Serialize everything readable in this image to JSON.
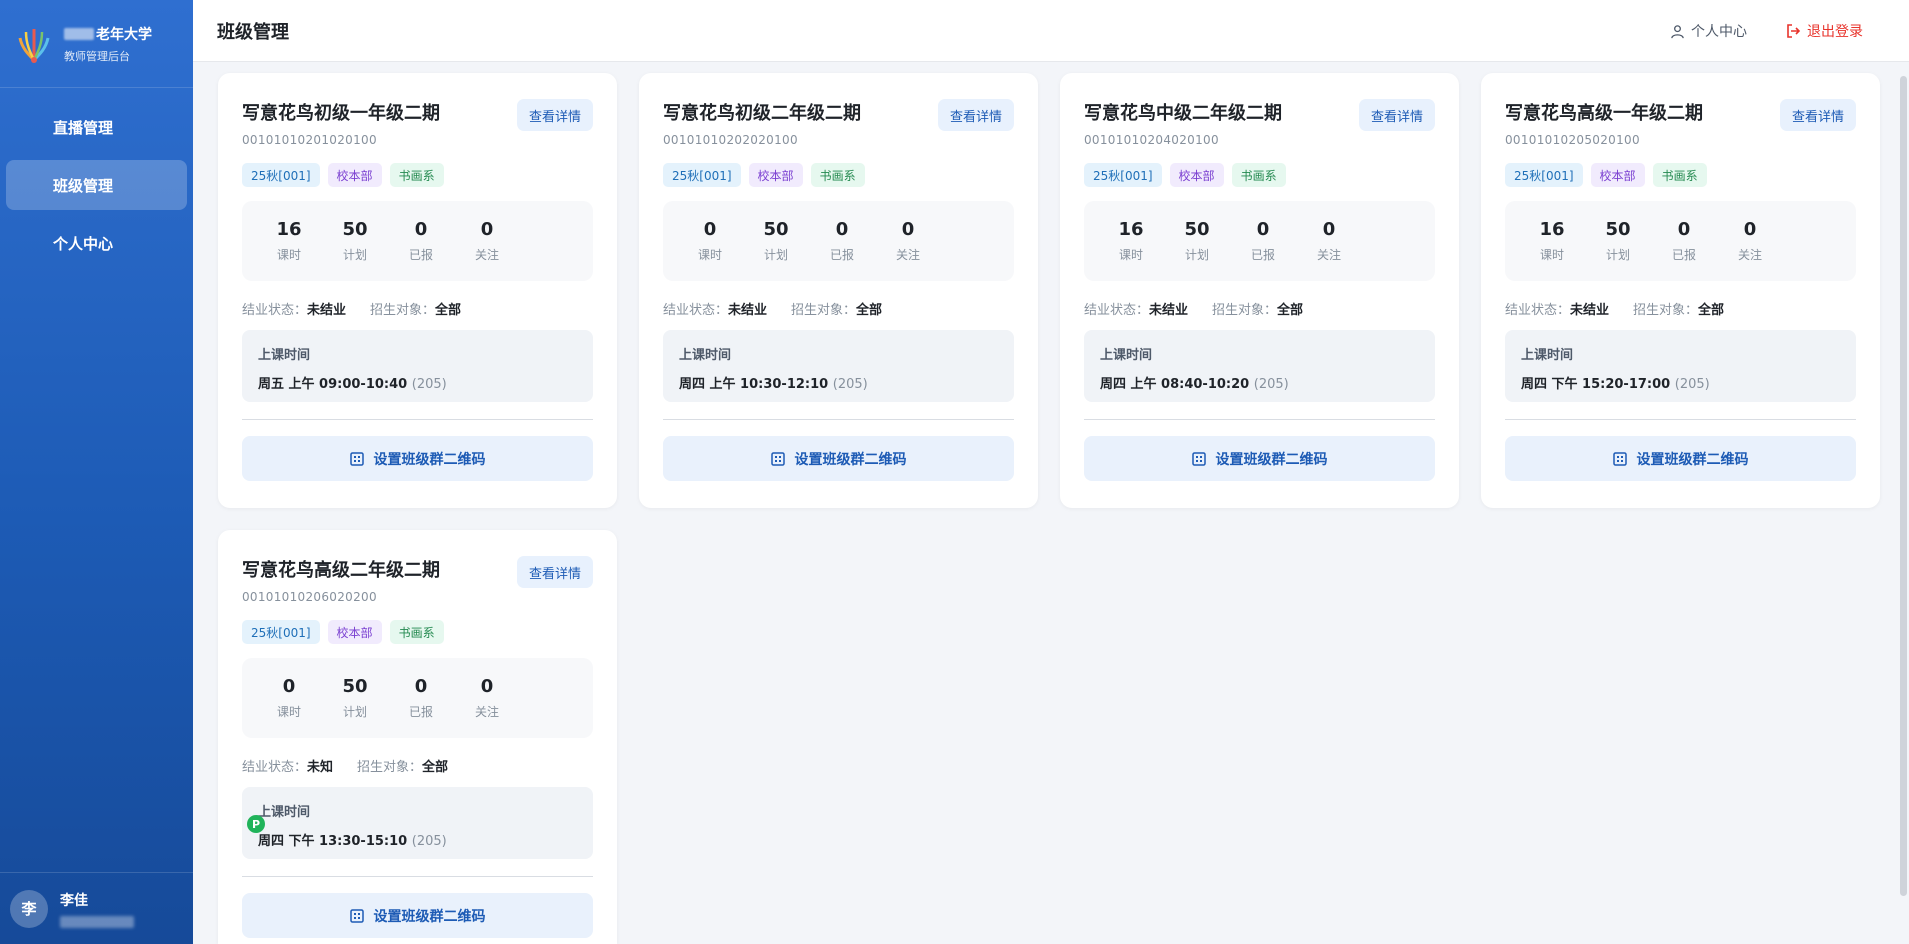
{
  "brand": {
    "name": "老年大学",
    "subtitle": "教师管理后台"
  },
  "sidebar": {
    "items": [
      {
        "label": "直播管理",
        "active": false
      },
      {
        "label": "班级管理",
        "active": true
      },
      {
        "label": "个人中心",
        "active": false
      }
    ]
  },
  "user": {
    "avatar_char": "李",
    "name": "李佳"
  },
  "header": {
    "title": "班级管理",
    "profile_label": "个人中心",
    "logout_label": "退出登录"
  },
  "labels": {
    "detail": "查看详情",
    "stat_lessons": "课时",
    "stat_plan": "计划",
    "stat_enrolled": "已报",
    "stat_follow": "关注",
    "status_label": "结业状态：",
    "target_label": "招生对象：",
    "time_label": "上课时间",
    "qr_button": "设置班级群二维码"
  },
  "cards": [
    {
      "title": "写意花鸟初级一年级二期",
      "code": "00101010201020100",
      "tags": [
        "25秋[001]",
        "校本部",
        "书画系"
      ],
      "lessons": "16",
      "plan": "50",
      "enrolled": "0",
      "follow": "0",
      "status": "未结业",
      "target": "全部",
      "time": "周五 上午 09:00-10:40",
      "room": "(205)"
    },
    {
      "title": "写意花鸟初级二年级二期",
      "code": "00101010202020100",
      "tags": [
        "25秋[001]",
        "校本部",
        "书画系"
      ],
      "lessons": "0",
      "plan": "50",
      "enrolled": "0",
      "follow": "0",
      "status": "未结业",
      "target": "全部",
      "time": "周四 上午 10:30-12:10",
      "room": "(205)"
    },
    {
      "title": "写意花鸟中级二年级二期",
      "code": "00101010204020100",
      "tags": [
        "25秋[001]",
        "校本部",
        "书画系"
      ],
      "lessons": "16",
      "plan": "50",
      "enrolled": "0",
      "follow": "0",
      "status": "未结业",
      "target": "全部",
      "time": "周四 上午 08:40-10:20",
      "room": "(205)"
    },
    {
      "title": "写意花鸟高级一年级二期",
      "code": "00101010205020100",
      "tags": [
        "25秋[001]",
        "校本部",
        "书画系"
      ],
      "lessons": "16",
      "plan": "50",
      "enrolled": "0",
      "follow": "0",
      "status": "未结业",
      "target": "全部",
      "time": "周四 下午 15:20-17:00",
      "room": "(205)"
    },
    {
      "title": "写意花鸟高级二年级二期",
      "code": "00101010206020200",
      "tags": [
        "25秋[001]",
        "校本部",
        "书画系"
      ],
      "lessons": "0",
      "plan": "50",
      "enrolled": "0",
      "follow": "0",
      "status": "未知",
      "target": "全部",
      "time": "周四 下午 13:30-15:10",
      "room": "(205)"
    }
  ]
}
